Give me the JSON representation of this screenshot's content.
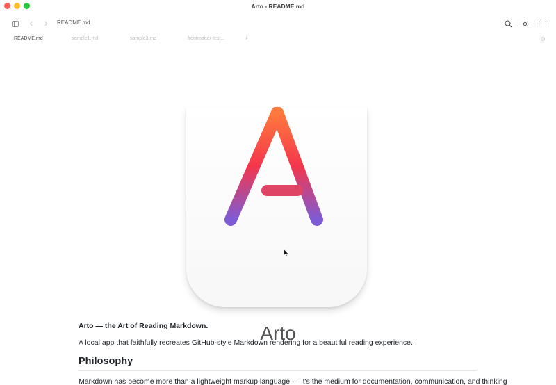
{
  "window": {
    "title": "Arto - README.md"
  },
  "toolbar": {
    "breadcrumb": "README.md",
    "icons": [
      "sidebar-toggle-icon",
      "back-arrow-icon",
      "forward-arrow-icon",
      "search-icon",
      "sun-icon",
      "list-icon"
    ]
  },
  "tabs": {
    "items": [
      {
        "label": "README.md",
        "active": true
      },
      {
        "label": "sample1.md",
        "active": false
      },
      {
        "label": "sample3.md",
        "active": false
      },
      {
        "label": "frontmatter-test...",
        "active": false
      }
    ],
    "add_label": "+"
  },
  "document": {
    "app_name": "Arto",
    "tagline": "Arto — the Art of Reading Markdown.",
    "description": "A local app that faithfully recreates GitHub-style Markdown rendering for a beautiful reading experience.",
    "section_heading": "Philosophy",
    "section_text": "Markdown has become more than a lightweight markup language — it's the medium for documentation, communication, and thinking"
  },
  "colors": {
    "close": "#fe5f57",
    "minimize": "#febc2e",
    "maximize": "#28c840",
    "logo_gradient": [
      "#ff7a3d",
      "#f4364c",
      "#7e5bd6"
    ]
  }
}
